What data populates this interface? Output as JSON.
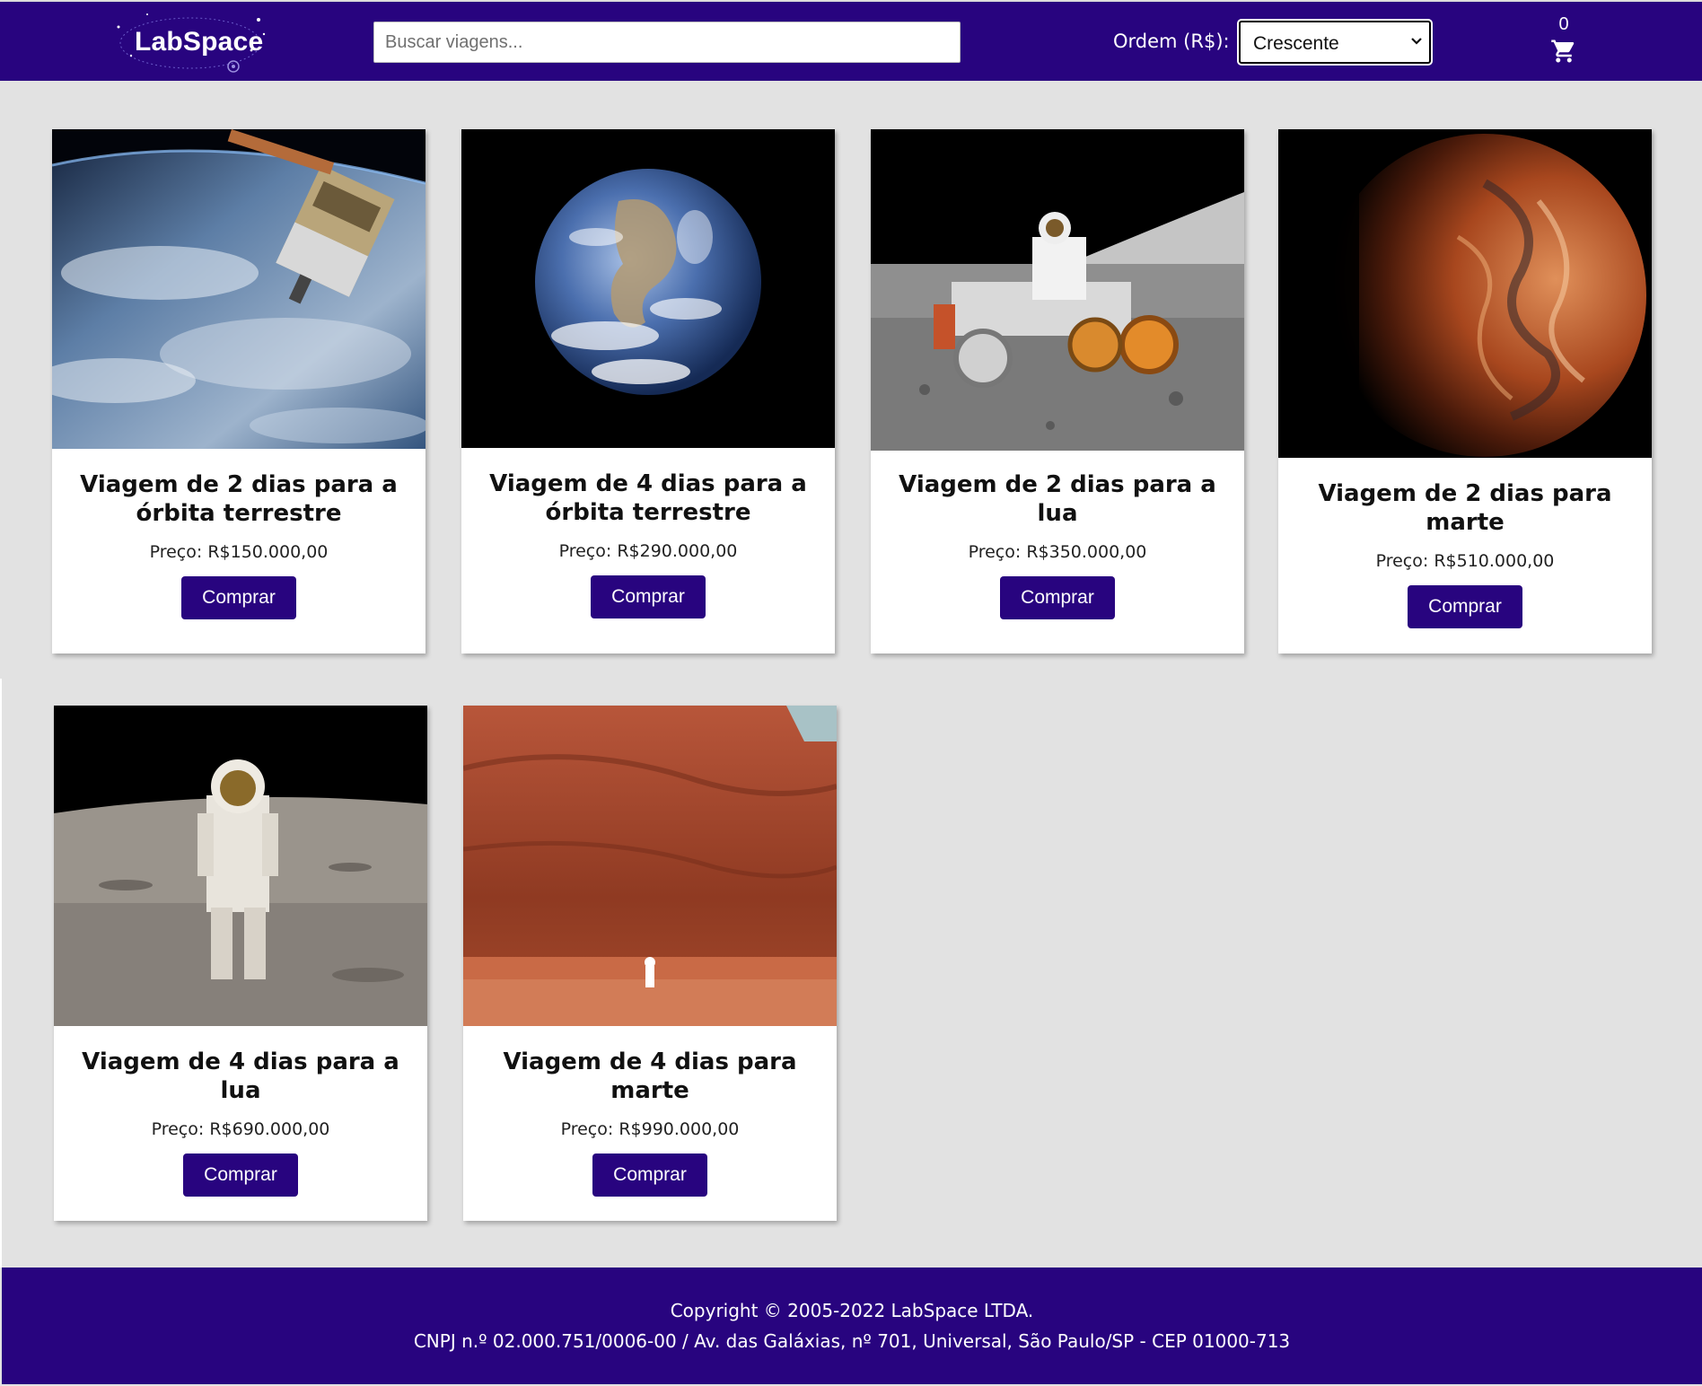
{
  "header": {
    "logo_text": "LabSpace",
    "search_placeholder": "Buscar viagens...",
    "order_label": "Ordem (R$):",
    "order_value": "Crescente",
    "cart_count": "0",
    "brand_color": "#28047f"
  },
  "products": [
    {
      "title": "Viagem de 2 dias para a órbita terrestre",
      "price": "Preço: R$150.000,00",
      "button": "Comprar",
      "image": "earth-orbit-with-space-station"
    },
    {
      "title": "Viagem de 4 dias para a órbita terrestre",
      "price": "Preço: R$290.000,00",
      "button": "Comprar",
      "image": "earth-globe"
    },
    {
      "title": "Viagem de 2 dias para a lua",
      "price": "Preço: R$350.000,00",
      "button": "Comprar",
      "image": "astronaut-on-lunar-rover"
    },
    {
      "title": "Viagem de 2 dias para marte",
      "price": "Preço: R$510.000,00",
      "button": "Comprar",
      "image": "mars-planet"
    },
    {
      "title": "Viagem de 4 dias para a lua",
      "price": "Preço: R$690.000,00",
      "button": "Comprar",
      "image": "astronaut-on-moon"
    },
    {
      "title": "Viagem de 4 dias para marte",
      "price": "Preço: R$990.000,00",
      "button": "Comprar",
      "image": "astronaut-by-red-cliff"
    }
  ],
  "footer": {
    "copyright": "Copyright © 2005-2022 LabSpace LTDA.",
    "address": "CNPJ n.º 02.000.751/0006-00 / Av. das Galáxias, nº 701, Universal, São Paulo/SP - CEP 01000-713"
  }
}
